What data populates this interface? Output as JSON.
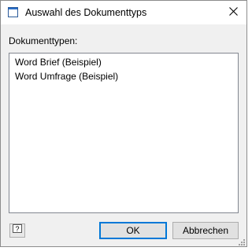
{
  "window": {
    "title": "Auswahl des Dokumenttyps",
    "icon": "window-icon",
    "close_icon": "close-icon"
  },
  "section": {
    "label": "Dokumenttypen:"
  },
  "document_types": [
    "Word Brief (Beispiel)",
    "Word Umfrage (Beispiel)"
  ],
  "footer": {
    "help_icon": "help-icon",
    "ok_label": "OK",
    "cancel_label": "Abbrechen"
  },
  "colors": {
    "dialog_background": "#f0f0f0",
    "titlebar_background": "#ffffff",
    "default_button_border": "#0078d7"
  }
}
